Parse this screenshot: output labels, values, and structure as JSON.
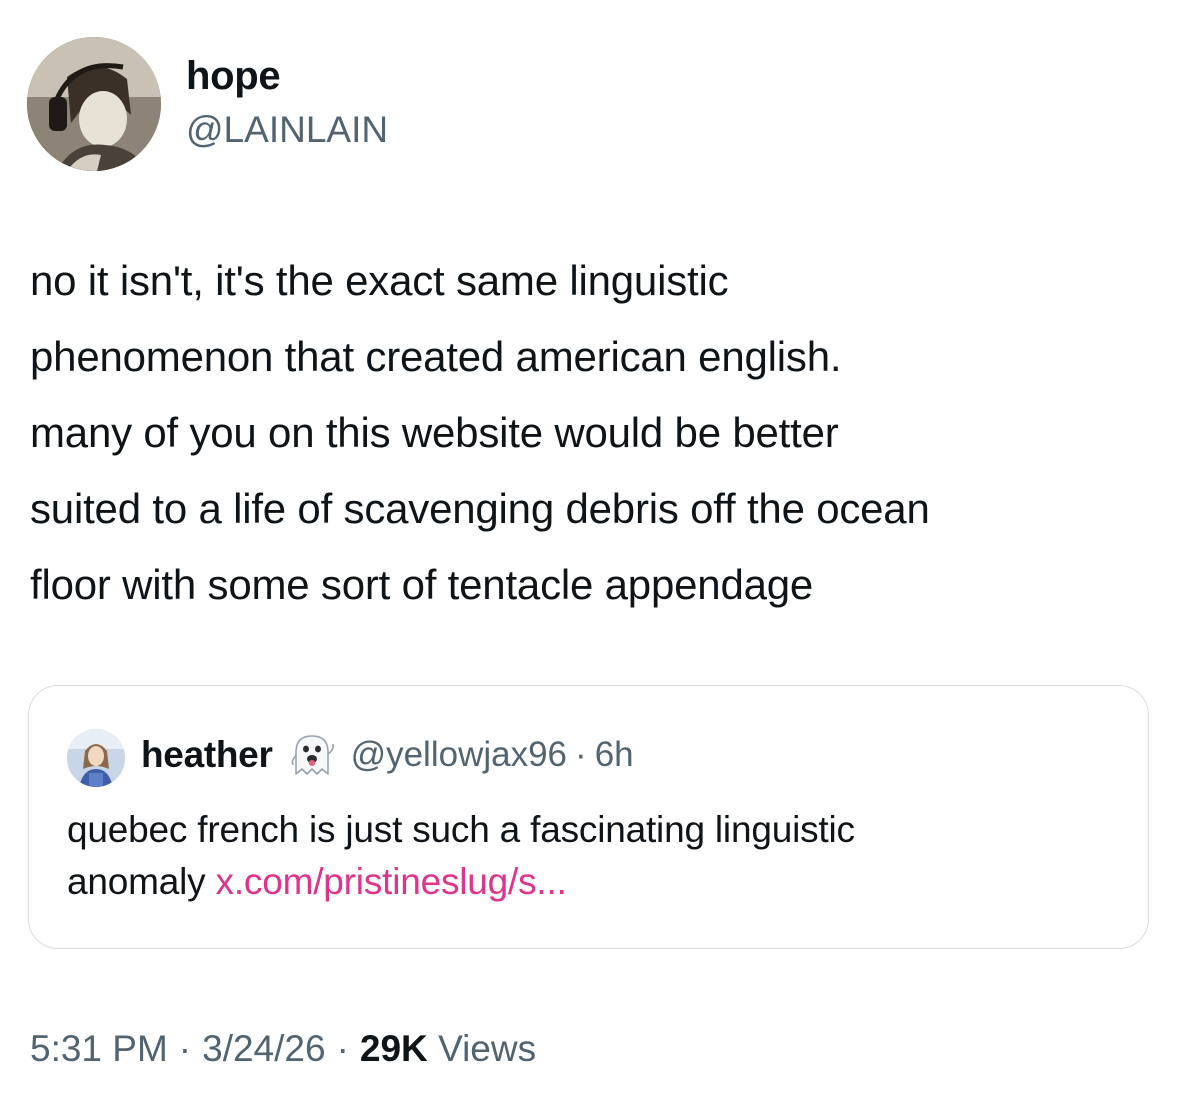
{
  "tweet": {
    "author": {
      "name": "hope",
      "handle": "@LAINLAIN"
    },
    "text_lines": [
      "no it isn't, it's the exact same linguistic",
      "phenomenon that created american english.",
      "many of you on this website would be better",
      "suited to a life of scavenging debris off the ocean",
      "floor with some sort of tentacle appendage"
    ],
    "quote": {
      "author_name": "heather",
      "emoji_icon": "ghost-emoji",
      "author_handle": "@yellowjax96",
      "separator": "·",
      "time_ago": "6h",
      "text_line1": "quebec french is just such a fascinating linguistic",
      "text_line2": "anomaly",
      "link_text": "x.com/pristineslug/s...",
      "link_color": "#e0338a"
    },
    "meta": {
      "time": "5:31 PM",
      "separator": "·",
      "date": "3/24/26",
      "views_count": "29K",
      "views_label": "Views"
    }
  },
  "colors": {
    "text_primary": "#0f1419",
    "text_secondary": "#536471",
    "card_border": "#d7dde2",
    "background": "#ffffff"
  }
}
